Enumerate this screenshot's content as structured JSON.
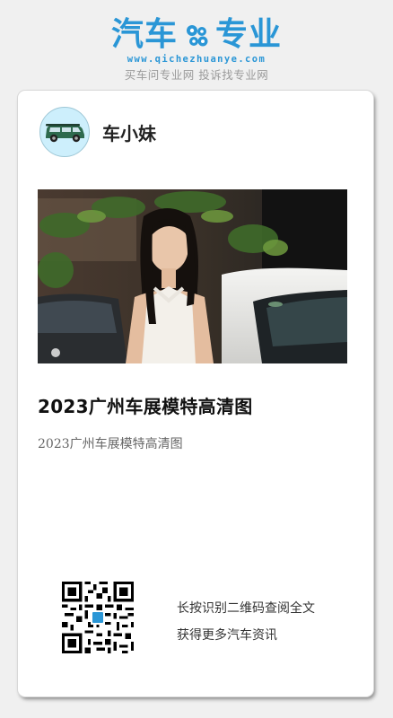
{
  "brand": {
    "logo_left": "汽车",
    "logo_right": "专业",
    "url": "www.qichezhuanye.com",
    "slogan": "买车问专业网 投诉找专业网",
    "color": "#2a96d6"
  },
  "author": {
    "name": "车小妹",
    "avatar_icon": "car-avatar-icon"
  },
  "article": {
    "title": "2023广州车展模特高清图",
    "subtitle": "2023广州车展模特高清图"
  },
  "qr": {
    "line1": "长按识别二维码查阅全文",
    "line2": "获得更多汽车资讯"
  }
}
